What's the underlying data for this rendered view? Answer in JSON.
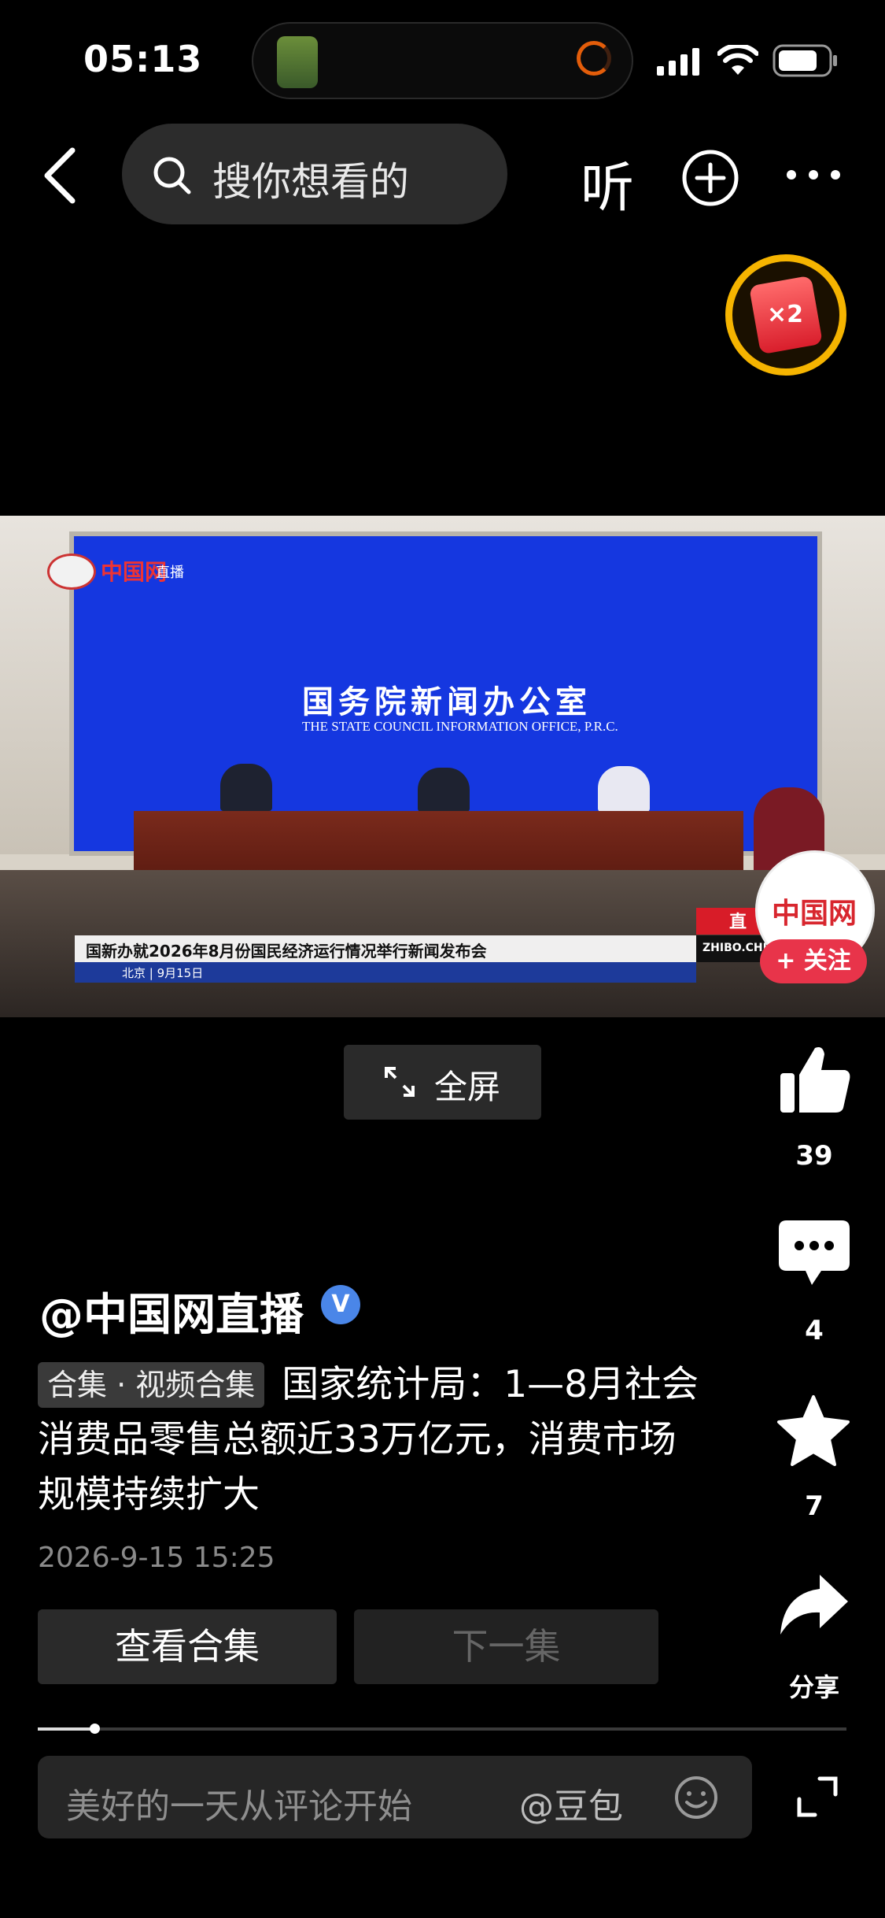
{
  "status_bar": {
    "time": "05:13"
  },
  "top_bar": {
    "search_placeholder": "搜你想看的",
    "listen_label": "听"
  },
  "reward_badge": {
    "label": "×2"
  },
  "video": {
    "backdrop_title_cn": "国务院新闻办公室",
    "backdrop_title_en": "THE STATE COUNCIL INFORMATION OFFICE, P.R.C.",
    "logo_text": "中国网",
    "logo_sub": "直播",
    "caption": "国新办就2026年8月份国民经济运行情况举行新闻发布会",
    "caption_sub": "北京 | 9月15日",
    "live_tag": "直",
    "site_tag": "ZHIBO.CHINA",
    "follow_label": "+ 关注",
    "fullscreen_label": "全屏"
  },
  "rail": {
    "likes": "39",
    "comments": "4",
    "favorites": "7",
    "share_label": "分享"
  },
  "post": {
    "author": "@中国网直播",
    "verified": "V",
    "tag": "合集 · 视频合集",
    "title": "国家统计局：1—8月社会消费品零售总额近33万亿元，消费市场规模持续扩大",
    "date": "2026-9-15 15:25",
    "view_collection": "查看合集",
    "next_episode": "下一集"
  },
  "comment_bar": {
    "placeholder": "美好的一天从评论开始",
    "mention": "@豆包"
  },
  "colors": {
    "accent_red": "#e8344a",
    "verified_blue": "#4a86e8",
    "stage_blue": "#1537e0"
  },
  "progress": {
    "fraction": 0.05
  }
}
